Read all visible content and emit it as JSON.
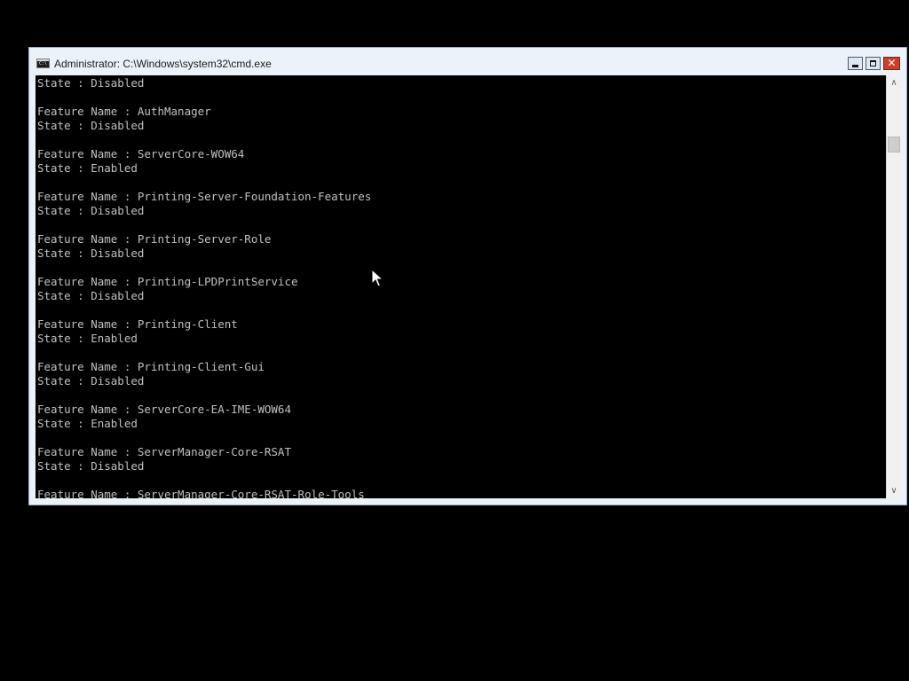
{
  "window": {
    "title": "Administrator: C:\\Windows\\system32\\cmd.exe",
    "app_icon_text": "C:\\"
  },
  "controls": {
    "minimize": "minimize",
    "maximize": "maximize",
    "close_glyph": "✕"
  },
  "console": {
    "lines": [
      "State : Disabled",
      "",
      "Feature Name : AuthManager",
      "State : Disabled",
      "",
      "Feature Name : ServerCore-WOW64",
      "State : Enabled",
      "",
      "Feature Name : Printing-Server-Foundation-Features",
      "State : Disabled",
      "",
      "Feature Name : Printing-Server-Role",
      "State : Disabled",
      "",
      "Feature Name : Printing-LPDPrintService",
      "State : Disabled",
      "",
      "Feature Name : Printing-Client",
      "State : Enabled",
      "",
      "Feature Name : Printing-Client-Gui",
      "State : Disabled",
      "",
      "Feature Name : ServerCore-EA-IME-WOW64",
      "State : Enabled",
      "",
      "Feature Name : ServerManager-Core-RSAT",
      "State : Disabled",
      "",
      "Feature Name : ServerManager-Core-RSAT-Role-Tools"
    ]
  },
  "scrollbar": {
    "up_arrow": "∧",
    "down_arrow": "∨"
  },
  "colors": {
    "console_background": "#000000",
    "console_text": "#c0c0c0",
    "close_button": "#c7402c"
  }
}
